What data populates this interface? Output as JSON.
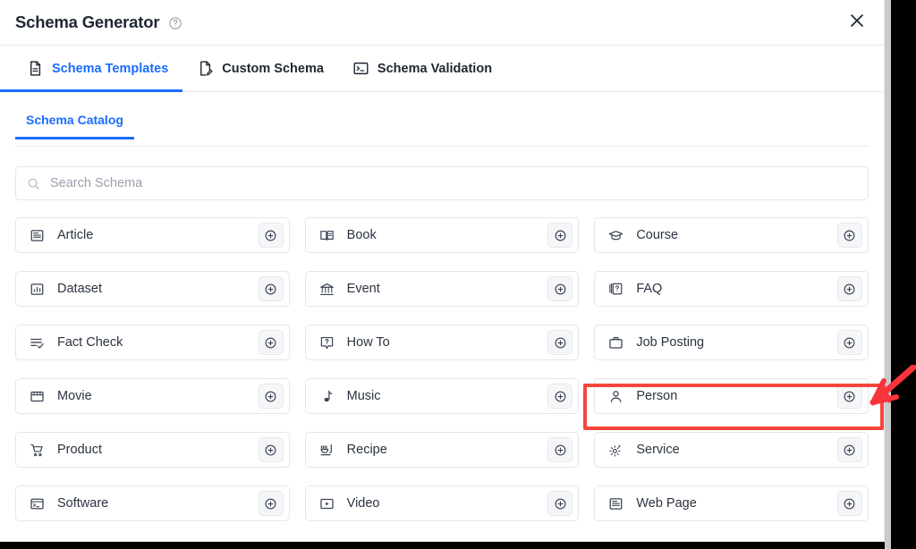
{
  "window": {
    "title": "Schema Generator",
    "help_icon": "help-circle-icon",
    "close_icon": "close-icon"
  },
  "tabs": [
    {
      "label": "Schema Templates",
      "icon": "document-icon",
      "active": true
    },
    {
      "label": "Custom Schema",
      "icon": "document-edit-icon",
      "active": false
    },
    {
      "label": "Schema Validation",
      "icon": "terminal-icon",
      "active": false
    }
  ],
  "subtabs": [
    {
      "label": "Schema Catalog",
      "active": true
    }
  ],
  "search": {
    "placeholder": "Search Schema",
    "value": "",
    "icon": "search-icon"
  },
  "schema_cards": [
    {
      "label": "Article",
      "icon": "article-icon",
      "add_icon": "plus-circle-icon"
    },
    {
      "label": "Book",
      "icon": "book-icon",
      "add_icon": "plus-circle-icon"
    },
    {
      "label": "Course",
      "icon": "graduation-cap-icon",
      "add_icon": "plus-circle-icon"
    },
    {
      "label": "Dataset",
      "icon": "chart-box-icon",
      "add_icon": "plus-circle-icon"
    },
    {
      "label": "Event",
      "icon": "event-bank-icon",
      "add_icon": "plus-circle-icon"
    },
    {
      "label": "FAQ",
      "icon": "faq-question-icon",
      "add_icon": "plus-circle-icon"
    },
    {
      "label": "Fact Check",
      "icon": "fact-check-icon",
      "add_icon": "plus-circle-icon"
    },
    {
      "label": "How To",
      "icon": "how-to-icon",
      "add_icon": "plus-circle-icon"
    },
    {
      "label": "Job Posting",
      "icon": "briefcase-icon",
      "add_icon": "plus-circle-icon"
    },
    {
      "label": "Movie",
      "icon": "clapperboard-icon",
      "add_icon": "plus-circle-icon"
    },
    {
      "label": "Music",
      "icon": "music-note-icon",
      "add_icon": "plus-circle-icon"
    },
    {
      "label": "Person",
      "icon": "person-icon",
      "add_icon": "plus-circle-icon",
      "highlighted": true
    },
    {
      "label": "Product",
      "icon": "shopping-cart-icon",
      "add_icon": "plus-circle-icon"
    },
    {
      "label": "Recipe",
      "icon": "recipe-icon",
      "add_icon": "plus-circle-icon"
    },
    {
      "label": "Service",
      "icon": "gear-icon",
      "add_icon": "plus-circle-icon"
    },
    {
      "label": "Software",
      "icon": "software-window-icon",
      "add_icon": "plus-circle-icon"
    },
    {
      "label": "Video",
      "icon": "video-play-icon",
      "add_icon": "plus-circle-icon"
    },
    {
      "label": "Web Page",
      "icon": "web-page-icon",
      "add_icon": "plus-circle-icon"
    }
  ],
  "annotation": {
    "highlight_target": "Person",
    "highlight_color": "#f8453c",
    "arrow_color": "#f8333a"
  },
  "colors": {
    "accent": "#1a6dff",
    "text": "#2b3340",
    "border": "#e4e6ea",
    "placeholder": "#9aa1ac"
  }
}
